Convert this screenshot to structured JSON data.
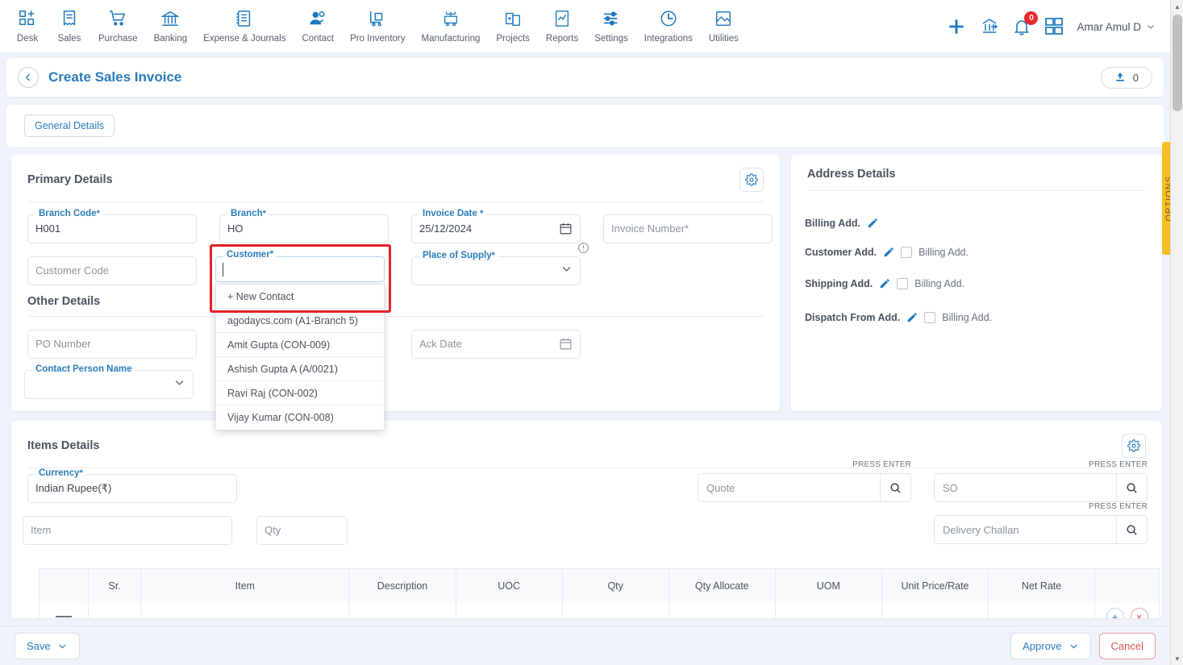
{
  "topnav": {
    "items": [
      {
        "label": "Desk",
        "icon": "dashboard-icon"
      },
      {
        "label": "Sales",
        "icon": "receipt-icon"
      },
      {
        "label": "Purchase",
        "icon": "cart-icon"
      },
      {
        "label": "Banking",
        "icon": "bank-icon"
      },
      {
        "label": "Expense & Journals",
        "icon": "journal-icon"
      },
      {
        "label": "Contact",
        "icon": "contacts-icon"
      },
      {
        "label": "Pro Inventory",
        "icon": "inventory-trolley-icon"
      },
      {
        "label": "Manufacturing",
        "icon": "manufacturing-icon"
      },
      {
        "label": "Projects",
        "icon": "projects-icon"
      },
      {
        "label": "Reports",
        "icon": "reports-icon"
      },
      {
        "label": "Settings",
        "icon": "sliders-icon"
      },
      {
        "label": "Integrations",
        "icon": "plug-icon"
      },
      {
        "label": "Utilities",
        "icon": "utilities-icon"
      }
    ],
    "notification_count": "0",
    "user_name": "Amar Amul D"
  },
  "page_header": {
    "title": "Create Sales Invoice",
    "attachment_count": "0"
  },
  "tabs": [
    {
      "label": "General Details",
      "active": true
    }
  ],
  "primary_details": {
    "title": "Primary Details",
    "branch_code": {
      "label": "Branch Code",
      "required": "*",
      "value": "H001"
    },
    "branch": {
      "label": "Branch",
      "required": "*",
      "value": "HO"
    },
    "invoice_date": {
      "label": "Invoice Date",
      "required": "*",
      "value": "25/12/2024"
    },
    "invoice_number": {
      "placeholder": "Invoice Number",
      "required": "*"
    },
    "customer_code": {
      "placeholder": "Customer Code"
    },
    "customer": {
      "label": "Customer",
      "required": "*",
      "value": ""
    },
    "place_of_supply": {
      "label": "Place of Supply",
      "required": "*",
      "value": ""
    }
  },
  "customer_dropdown": {
    "new_contact": "+ New Contact",
    "options": [
      "agodaycs.com (A1-Branch 5)",
      "Amit Gupta (CON-009)",
      "Ashish Gupta A (A/0021)",
      "Ravi Raj (CON-002)",
      "Vijay Kumar (CON-008)"
    ]
  },
  "other_details": {
    "title": "Other Details",
    "po_number": {
      "placeholder": "PO Number"
    },
    "contact_person_name": {
      "label": "Contact Person Name",
      "value": ""
    },
    "ack_date": {
      "placeholder": "Ack Date"
    }
  },
  "address_details": {
    "title": "Address Details",
    "rows": [
      {
        "label": "Billing Add.",
        "has_checkbox": false,
        "checkbox_label": ""
      },
      {
        "label": "Customer Add.",
        "has_checkbox": true,
        "checkbox_label": "Billing Add.",
        "checked": false
      },
      {
        "label": "Shipping Add.",
        "has_checkbox": true,
        "checkbox_label": "Billing Add.",
        "checked": false
      },
      {
        "label": "Dispatch From Add.",
        "has_checkbox": true,
        "checkbox_label": "Billing Add.",
        "checked": false
      }
    ]
  },
  "items_details": {
    "title": "Items Details",
    "currency": {
      "label": "Currency",
      "required": "*",
      "value": "Indian Rupee(₹)"
    },
    "item": {
      "placeholder": "Item"
    },
    "qty": {
      "placeholder": "Qty"
    },
    "press_enter_label": "PRESS ENTER",
    "quote": {
      "placeholder": "Quote"
    },
    "so": {
      "placeholder": "SO"
    },
    "delivery_challan": {
      "placeholder": "Delivery Challan"
    },
    "table": {
      "columns": [
        "",
        "Sr.",
        "Item",
        "Description",
        "UOC",
        "Qty",
        "Qty Allocate",
        "UOM",
        "Unit Price/Rate",
        "Net Rate",
        ""
      ],
      "rows": [
        {
          "cells": [
            "",
            "",
            "",
            "",
            "",
            "",
            "",
            "",
            "",
            "",
            ""
          ]
        }
      ]
    }
  },
  "options_tab": {
    "label": "OPTIONS"
  },
  "footer": {
    "save_label": "Save",
    "approve_label": "Approve",
    "cancel_label": "Cancel"
  },
  "colors": {
    "accent": "#2a7cbb",
    "brand_icon": "#1c79c0",
    "highlight_red": "#e32227",
    "danger": "#d9534f",
    "options_yellow": "#f6c022",
    "badge_red": "#e8292f"
  }
}
